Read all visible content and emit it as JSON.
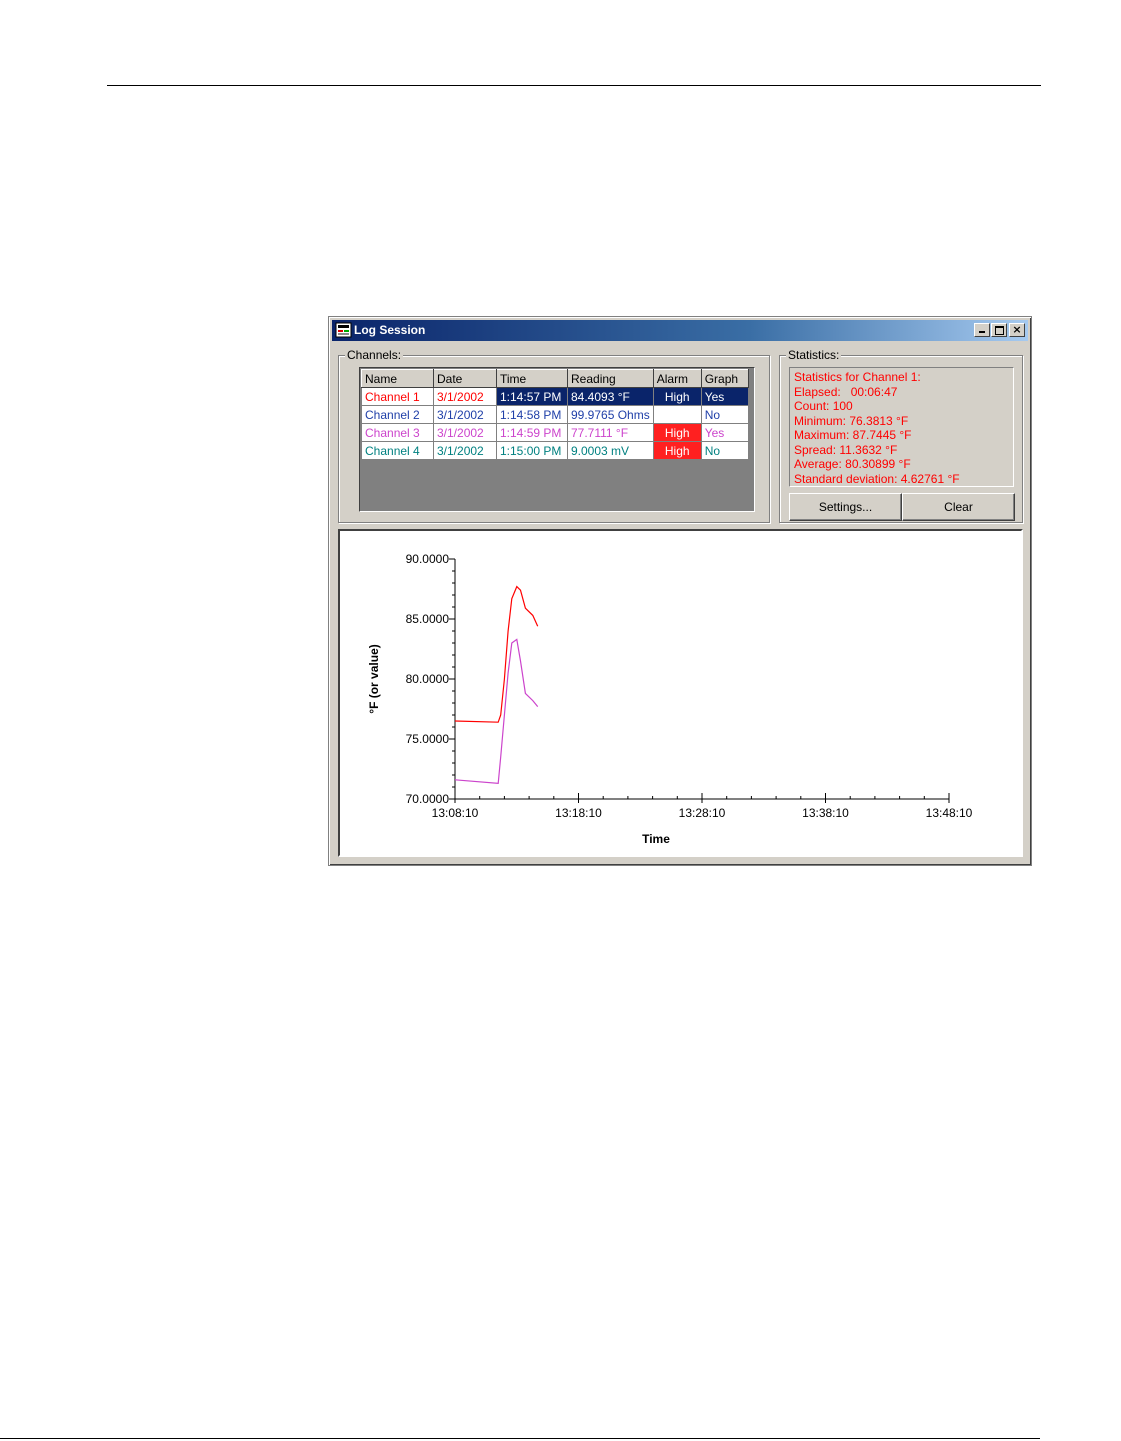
{
  "window": {
    "title": "Log Session"
  },
  "channels": {
    "label": "Channels:",
    "columns": [
      "Name",
      "Date",
      "Time",
      "Reading",
      "Alarm",
      "Graph"
    ],
    "rows": [
      {
        "name": "Channel 1",
        "date": "3/1/2002",
        "time": "1:14:57 PM",
        "reading": "84.4093 °F",
        "alarm": "High",
        "graph": "Yes",
        "color": "#ff0000",
        "selected": true
      },
      {
        "name": "Channel 2",
        "date": "3/1/2002",
        "time": "1:14:58 PM",
        "reading": "99.9765 Ohms",
        "alarm": "",
        "graph": "No",
        "color": "#1f3fa8",
        "selected": false
      },
      {
        "name": "Channel 3",
        "date": "3/1/2002",
        "time": "1:14:59 PM",
        "reading": "77.7111 °F",
        "alarm": "High",
        "graph": "Yes",
        "color": "#cc44cc",
        "selected": false
      },
      {
        "name": "Channel 4",
        "date": "3/1/2002",
        "time": "1:15:00 PM",
        "reading": "9.0003 mV",
        "alarm": "High",
        "graph": "No",
        "color": "#008080",
        "selected": false
      }
    ]
  },
  "statistics": {
    "label": "Statistics:",
    "lines": [
      "Statistics for Channel 1:",
      "Elapsed:   00:06:47",
      "Count: 100",
      "Minimum: 76.3813 °F",
      "Maximum: 87.7445 °F",
      "Spread: 11.3632 °F",
      "Average: 80.30899 °F",
      "Standard deviation: 4.62761 °F"
    ],
    "settings_label": "Settings...",
    "clear_label": "Clear"
  },
  "colors": {
    "selection": "#0a246a",
    "alarm": "#ff2020",
    "stats_text": "#ff0000"
  },
  "chart_data": {
    "type": "line",
    "xlabel": "Time",
    "ylabel": "°F (or value)",
    "ylim": [
      70,
      90
    ],
    "y_ticks": [
      "90.0000",
      "85.0000",
      "80.0000",
      "75.0000",
      "70.0000"
    ],
    "x_ticks": [
      "13:08:10",
      "13:18:10",
      "13:28:10",
      "13:38:10",
      "13:48:10"
    ],
    "xlim_minutes": [
      0,
      40
    ],
    "series": [
      {
        "color": "#ff0000",
        "x": [
          0,
          3.5,
          3.7,
          4.0,
          4.3,
          4.6,
          5.0,
          5.3,
          5.7,
          6.3,
          6.7
        ],
        "y": [
          76.5,
          76.4,
          77,
          80,
          84,
          86.7,
          87.7,
          87.4,
          85.9,
          85.3,
          84.4
        ]
      },
      {
        "color": "#cc44cc",
        "x": [
          0,
          3.5,
          3.7,
          4.0,
          4.3,
          4.6,
          5.0,
          5.3,
          5.7,
          6.3,
          6.7
        ],
        "y": [
          71.6,
          71.3,
          73.5,
          77,
          80.5,
          83,
          83.3,
          81.5,
          78.8,
          78.2,
          77.7
        ]
      }
    ]
  }
}
